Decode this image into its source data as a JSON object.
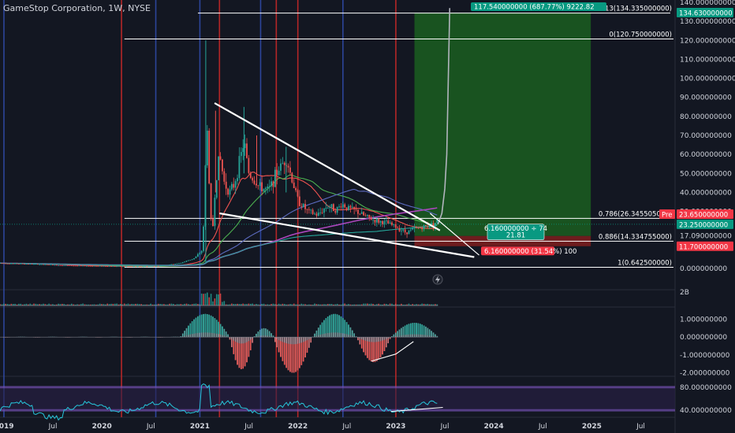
{
  "header": {
    "title": "GameStop Corporation, 1W, NYSE"
  },
  "colors": {
    "background": "#131722",
    "up": "#26a69a",
    "down": "#ef5350",
    "green_zone": "#1b5e20",
    "red_line": "#c62828",
    "blue_line": "#1e3a8a",
    "price_green": "#089981",
    "price_red": "#f23645",
    "rsi_line": "#26c6da",
    "rsi_band": "#7e57c2"
  },
  "chart_data": [
    {
      "type": "candlestick",
      "title": "GameStop Corporation, 1W, NYSE",
      "ylim": [
        -5,
        140
      ],
      "y_ticks": [
        "140.000000000",
        "130.000000000",
        "120.000000000",
        "110.000000000",
        "100.000000000",
        "90.000000000",
        "80.000000000",
        "70.000000000",
        "60.000000000",
        "50.000000000",
        "40.000000000",
        "30.000000000",
        "17.090000000",
        "0.000000000"
      ],
      "y_tick_values": [
        140,
        130,
        120,
        110,
        100,
        90,
        80,
        70,
        60,
        50,
        40,
        30,
        17.09,
        0
      ],
      "x_ticks": [
        "2019",
        "Jul",
        "2020",
        "Jul",
        "2021",
        "Jul",
        "2022",
        "Jul",
        "2023",
        "Jul",
        "2024",
        "Jul",
        "2025",
        "Jul"
      ],
      "x_tick_values": [
        2019.0,
        2019.5,
        2020.0,
        2020.5,
        2021.0,
        2021.5,
        2022.0,
        2022.5,
        2023.0,
        2023.5,
        2024.0,
        2024.5,
        2025.0,
        2025.5
      ],
      "xlim": [
        2018.96,
        2025.85
      ],
      "price_path": [
        [
          2018.96,
          2.8
        ],
        [
          2019.3,
          2.3
        ],
        [
          2019.6,
          1.6
        ],
        [
          2019.9,
          1.3
        ],
        [
          2020.2,
          1.1
        ],
        [
          2020.4,
          1.0
        ],
        [
          2020.6,
          1.4
        ],
        [
          2020.8,
          2.8
        ],
        [
          2020.95,
          5.5
        ],
        [
          2021.03,
          10
        ],
        [
          2021.06,
          60
        ],
        [
          2021.08,
          80
        ],
        [
          2021.1,
          30
        ],
        [
          2021.13,
          20
        ],
        [
          2021.16,
          45
        ],
        [
          2021.2,
          60
        ],
        [
          2021.25,
          45
        ],
        [
          2021.3,
          40
        ],
        [
          2021.35,
          44
        ],
        [
          2021.4,
          55
        ],
        [
          2021.45,
          67
        ],
        [
          2021.5,
          50
        ],
        [
          2021.6,
          43
        ],
        [
          2021.7,
          41
        ],
        [
          2021.8,
          52
        ],
        [
          2021.88,
          58
        ],
        [
          2021.95,
          45
        ],
        [
          2022.0,
          36
        ],
        [
          2022.1,
          30
        ],
        [
          2022.2,
          28
        ],
        [
          2022.3,
          33
        ],
        [
          2022.4,
          31
        ],
        [
          2022.45,
          34
        ],
        [
          2022.5,
          32
        ],
        [
          2022.6,
          30
        ],
        [
          2022.7,
          27
        ],
        [
          2022.8,
          25
        ],
        [
          2022.9,
          24
        ],
        [
          2023.0,
          22
        ],
        [
          2023.1,
          19
        ],
        [
          2023.2,
          21
        ],
        [
          2023.3,
          22
        ],
        [
          2023.35,
          23
        ],
        [
          2023.4,
          24
        ],
        [
          2023.43,
          25
        ]
      ],
      "lines": {
        "top_level": 134.335,
        "mid_level": 120.75,
        "level_0786": 26.3455,
        "level_0886": 14.3347,
        "level_1": 0.6425
      },
      "green_zone": {
        "x": [
          2023.19,
          2024.99
        ],
        "y": [
          17.09,
          134.63
        ]
      },
      "red_zone": {
        "x": [
          2023.19,
          2024.99
        ],
        "y": [
          11.7,
          17.09
        ]
      },
      "projection": [
        [
          2023.43,
          23.25
        ],
        [
          2023.47,
          29
        ],
        [
          2023.5,
          42
        ],
        [
          2023.52,
          60
        ],
        [
          2023.55,
          137
        ]
      ],
      "event_lines_red": [
        2020.2,
        2021.2,
        2021.78,
        2022.0,
        2023.0
      ],
      "event_lines_blue": [
        2019.0,
        2020.55,
        2021.0,
        2021.62,
        2022.46
      ],
      "fib_labels": [
        {
          "text": "1.13(134.335000000)",
          "value": 134.335
        },
        {
          "text": "0(120.750000000)",
          "value": 120.75
        },
        {
          "text": "0.786(26.345505000)",
          "value": 26.3455
        },
        {
          "text": "0.886(14.334755000)",
          "value": 14.3347
        },
        {
          "text": "1(0.642500000)",
          "value": 0.6425
        }
      ],
      "price_labels": [
        {
          "text": "134.630000000",
          "value": 134.63,
          "color": "#089981"
        },
        {
          "text": "23.650000000",
          "value": 28.6,
          "color": "#f23645",
          "prefix": "Pre"
        },
        {
          "text": "23.250000000",
          "value": 23.25,
          "color": "#089981"
        },
        {
          "text": "11.700000000",
          "value": 11.7,
          "color": "#f23645"
        }
      ],
      "annotations": {
        "target_box": "117.540000000 (687.77%) 9222.82",
        "stop_box": "6.160000000 (31.54%) 100",
        "rr_line1": "6.160000000 ÷ 74",
        "rr_line2": "21.81"
      }
    },
    {
      "type": "bar",
      "title": "",
      "y_ticks": [
        "2B"
      ],
      "y_tick_values": [
        2
      ],
      "ylim": [
        0,
        2.4
      ]
    },
    {
      "type": "bar",
      "title": "",
      "ylim": [
        -2.2,
        1.6
      ],
      "y_ticks": [
        "1.000000000",
        "0.000000000",
        "-1.000000000",
        "-2.000000000"
      ],
      "y_tick_values": [
        1,
        0,
        -1,
        -2
      ]
    },
    {
      "type": "line",
      "title": "",
      "ylim": [
        28,
        96
      ],
      "y_ticks": [
        "80.000000000",
        "40.000000000"
      ],
      "y_tick_values": [
        80,
        40
      ]
    }
  ]
}
